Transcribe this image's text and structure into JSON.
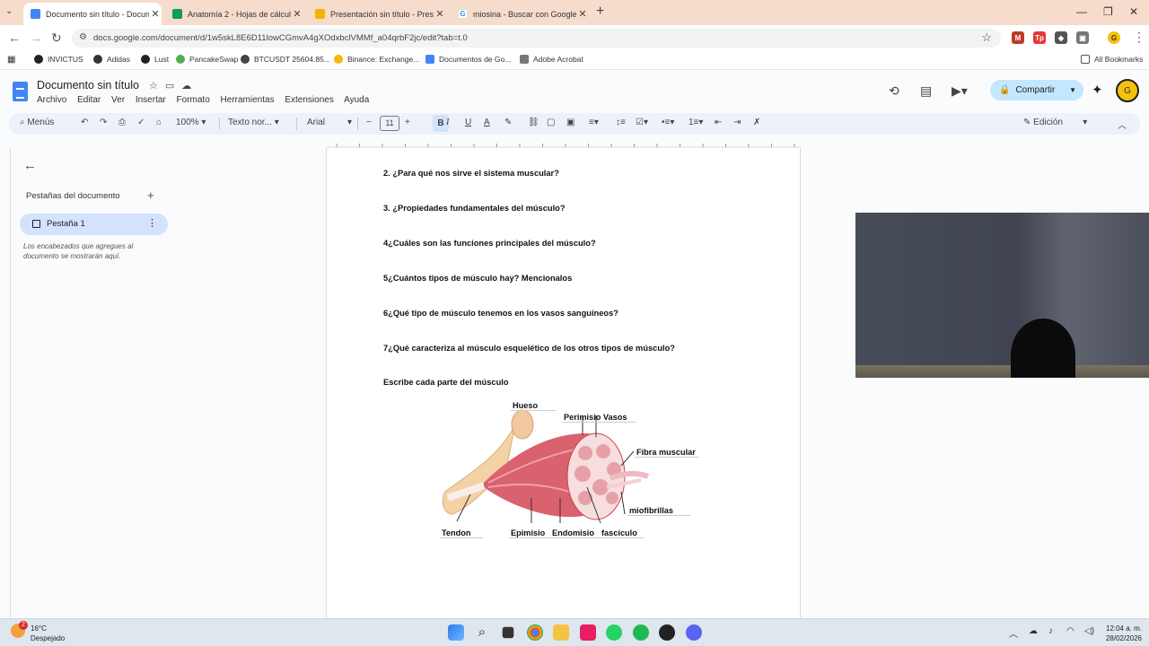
{
  "browser": {
    "tabs": [
      {
        "title": "Documento sin título - Docum",
        "favicon": "docs-icon",
        "active": true
      },
      {
        "title": "Anatomía 2 - Hojas de cálculo",
        "favicon": "sheets-icon",
        "active": false
      },
      {
        "title": "Presentación sin título - Presen",
        "favicon": "slides-icon",
        "active": false
      },
      {
        "title": "miosina - Buscar con Google",
        "favicon": "google-icon",
        "active": false
      }
    ],
    "url": "docs.google.com/document/d/1w5skL8E6D11lowCGmvA4gXOdxbclVMMf_a04qrbF2jc/edit?tab=t.0",
    "bookmarks": [
      "INVICTUS",
      "Adidas",
      "Lust",
      "PancakeSwap",
      "BTCUSDT 25604.85...",
      "Binance: Exchange...",
      "Documentos de Go...",
      "Adobe Acrobat"
    ],
    "all_bookmarks": "All Bookmarks"
  },
  "docs": {
    "title": "Documento sin título",
    "menus": [
      "Archivo",
      "Editar",
      "Ver",
      "Insertar",
      "Formato",
      "Herramientas",
      "Extensiones",
      "Ayuda"
    ],
    "share_label": "Compartir",
    "toolbar": {
      "search": "Menús",
      "zoom": "100%",
      "style": "Texto nor...",
      "font": "Arial",
      "font_size": "11",
      "mode": "Edición"
    }
  },
  "sidebar": {
    "title": "Pestañas del documento",
    "tab_label": "Pestaña 1",
    "hint": "Los encabezados que agregues al documento se mostrarán aquí."
  },
  "document": {
    "questions": [
      "2. ¿Para qué nos sirve el sistema muscular?",
      "3. ¿Propiedades fundamentales del músculo?",
      "4¿Cuáles son las funciones principales del músculo?",
      "5¿Cuántos tipos de músculo hay? Mencionalos",
      "6¿Qué tipo de músculo tenemos en los vasos sanguíneos?",
      "7¿Qué caracteriza al músculo esquelético de los otros tipos de músculo?",
      "Escribe cada parte del músculo"
    ],
    "diagram_labels": {
      "hueso": "Hueso",
      "perimisio": "Perimisio Vasos",
      "fibra": "Fibra muscular",
      "miofibrillas": "miofibrillas",
      "tendon": "Tendon",
      "epimisio": "Epimisio",
      "endomisio": "Endomisio",
      "fasciculo": "fascículo"
    }
  },
  "taskbar": {
    "weather_temp": "16°C",
    "weather_desc": "Despejado",
    "weather_badge": "2",
    "time": "12:04 a. m.",
    "date": "28/02/2026"
  }
}
